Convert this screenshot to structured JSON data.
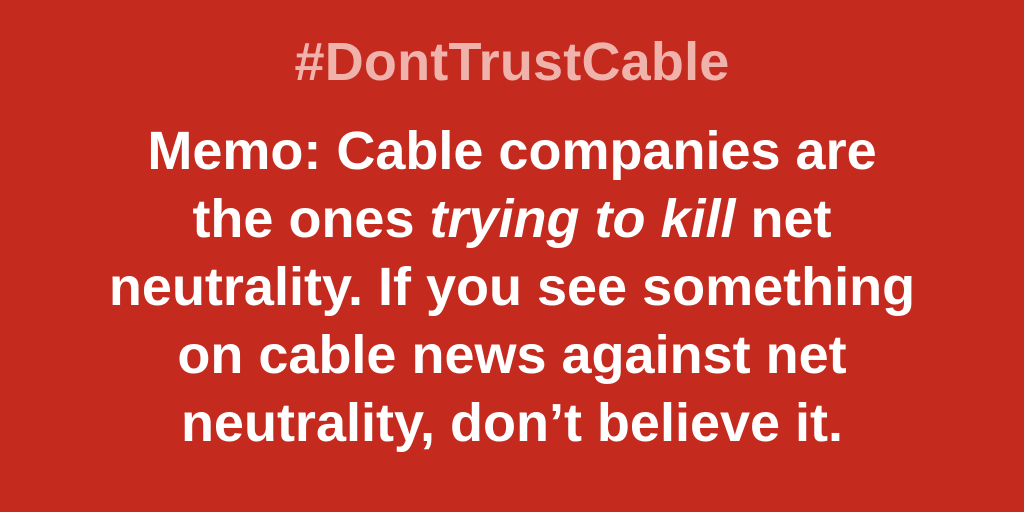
{
  "hashtag": "#DontTrustCable",
  "memo": {
    "line1": "Memo: Cable companies are",
    "line2_before": "the ones ",
    "line2_emphasis": "trying to kill",
    "line2_after": " net",
    "line3": "neutrality. If you see something",
    "line4": "on cable news against net",
    "line5": "neutrality, don’t believe it."
  },
  "colors": {
    "background": "#c52a1f",
    "hashtag": "#efb3ac",
    "text": "#ffffff"
  }
}
